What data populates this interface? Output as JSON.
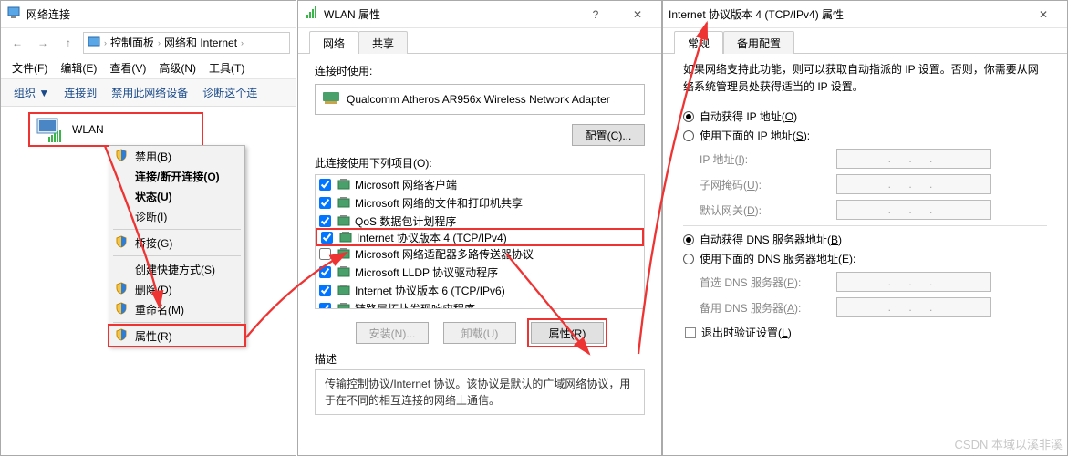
{
  "win_net": {
    "title": "网络连接",
    "breadcrumb": {
      "cpanel": "控制面板",
      "netinternet": "网络和 Internet"
    },
    "menu": {
      "file": "文件(F)",
      "edit": "编辑(E)",
      "view": "查看(V)",
      "adv": "高级(N)",
      "tools": "工具(T)"
    },
    "toolbar": {
      "org": "组织 ▼",
      "connect": "连接到",
      "disable": "禁用此网络设备",
      "diag": "诊断这个连"
    },
    "wlan_tile": {
      "name": "WLAN"
    }
  },
  "ctx": {
    "disable": "禁用(B)",
    "connect": "连接/断开连接(O)",
    "status": "状态(U)",
    "diagnose": "诊断(I)",
    "bridge": "桥接(G)",
    "shortcut": "创建快捷方式(S)",
    "delete": "删除(D)",
    "rename": "重命名(M)",
    "properties": "属性(R)"
  },
  "win_wlan": {
    "title": "WLAN 属性",
    "tab_net": "网络",
    "tab_share": "共享",
    "connect_using": "连接时使用:",
    "adapter": "Qualcomm Atheros AR956x Wireless Network Adapter",
    "configure_btn": "配置(C)...",
    "uses_items": "此连接使用下列项目(O):",
    "items": [
      {
        "label": "Microsoft 网络客户端",
        "checked": true
      },
      {
        "label": "Microsoft 网络的文件和打印机共享",
        "checked": true
      },
      {
        "label": "QoS 数据包计划程序",
        "checked": true
      },
      {
        "label": "Internet 协议版本 4 (TCP/IPv4)",
        "checked": true,
        "highlight": true
      },
      {
        "label": "Microsoft 网络适配器多路传送器协议",
        "checked": false
      },
      {
        "label": "Microsoft LLDP 协议驱动程序",
        "checked": true
      },
      {
        "label": "Internet 协议版本 6 (TCP/IPv6)",
        "checked": true
      },
      {
        "label": "链路层拓扑发现响应程序",
        "checked": true
      }
    ],
    "install_btn": "安装(N)...",
    "uninstall_btn": "卸载(U)",
    "properties_btn": "属性(R)",
    "desc_label": "描述",
    "desc_text": "传输控制协议/Internet 协议。该协议是默认的广域网络协议，用于在不同的相互连接的网络上通信。"
  },
  "win_ipv4": {
    "title": "Internet 协议版本 4 (TCP/IPv4) 属性",
    "tab_general": "常规",
    "tab_alt": "备用配置",
    "desc": "如果网络支持此功能，则可以获取自动指派的 IP 设置。否则，你需要从网络系统管理员处获得适当的 IP 设置。",
    "auto_ip": "自动获得 IP 地址(O)",
    "manual_ip": "使用下面的 IP 地址(S):",
    "ip_addr": "IP 地址(I):",
    "subnet": "子网掩码(U):",
    "gateway": "默认网关(D):",
    "auto_dns": "自动获得 DNS 服务器地址(B)",
    "manual_dns": "使用下面的 DNS 服务器地址(E):",
    "pref_dns": "首选 DNS 服务器(P):",
    "alt_dns": "备用 DNS 服务器(A):",
    "validate": "退出时验证设置(L)",
    "ip_empty": ".   .   ."
  },
  "watermark": "CSDN 本域以溪非溪"
}
